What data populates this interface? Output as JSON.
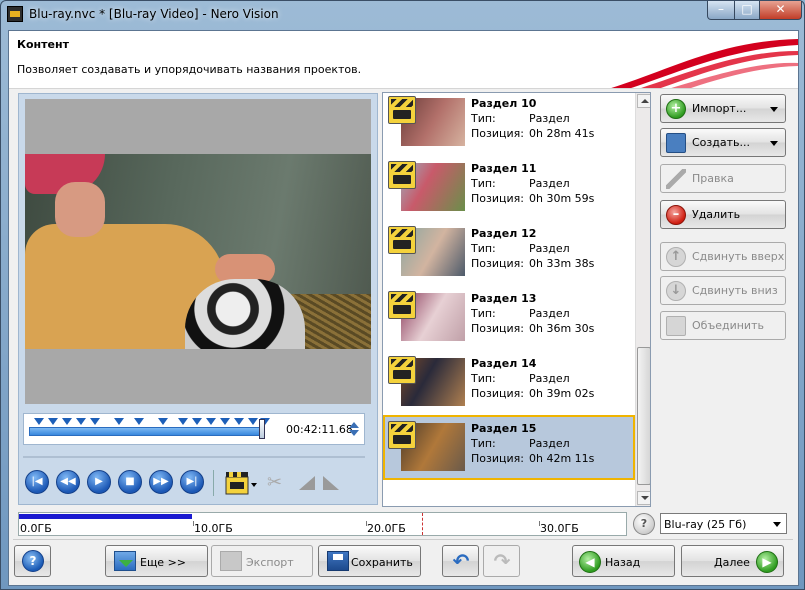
{
  "window": {
    "title": "Blu-ray.nvc * [Blu-ray Video] - Nero Vision",
    "minimize_glyph": "–",
    "maximize_glyph": "□",
    "close_glyph": "✕"
  },
  "header": {
    "title": "Контент",
    "description": "Позволяет создавать и упорядочивать названия проектов."
  },
  "preview": {
    "timecode": "00:42:11.68"
  },
  "chapters": {
    "type_label": "Тип:",
    "position_label": "Позиция:",
    "items": [
      {
        "title": "Раздел 10",
        "type": "Раздел",
        "position": "0h 28m 41s",
        "selected": false
      },
      {
        "title": "Раздел 11",
        "type": "Раздел",
        "position": "0h 30m 59s",
        "selected": false
      },
      {
        "title": "Раздел 12",
        "type": "Раздел",
        "position": "0h 33m 38s",
        "selected": false
      },
      {
        "title": "Раздел 13",
        "type": "Раздел",
        "position": "0h 36m 30s",
        "selected": false
      },
      {
        "title": "Раздел 14",
        "type": "Раздел",
        "position": "0h 39m 02s",
        "selected": false
      },
      {
        "title": "Раздел 15",
        "type": "Раздел",
        "position": "0h 42m 11s",
        "selected": true
      }
    ]
  },
  "side_buttons": {
    "import": "Импорт...",
    "create": "Создать...",
    "edit": "Правка",
    "delete": "Удалить",
    "move_up": "Сдвинуть вверх",
    "move_down": "Сдвинуть вниз",
    "merge": "Объединить"
  },
  "capacity": {
    "labels": [
      "0.0ГБ",
      "10.0ГБ",
      "20.0ГБ",
      "30.0ГБ"
    ],
    "used_fraction": 0.284,
    "disc": "Blu-ray (25 Гб)",
    "help_glyph": "?"
  },
  "bottom": {
    "help_glyph": "?",
    "more": "Еще >>",
    "export": "Экспорт",
    "save": "Сохранить",
    "back": "Назад",
    "next": "Далее"
  },
  "colors": {
    "selected_row": "#b7c8dc",
    "selected_border": "#f0b400",
    "accent_red": "#d3001e",
    "capacity_fill": "#1a1ad0"
  },
  "icons": {
    "undo": "↶",
    "redo": "↷",
    "scissors": "✂",
    "back_arrow": "◀",
    "next_arrow": "▶"
  }
}
